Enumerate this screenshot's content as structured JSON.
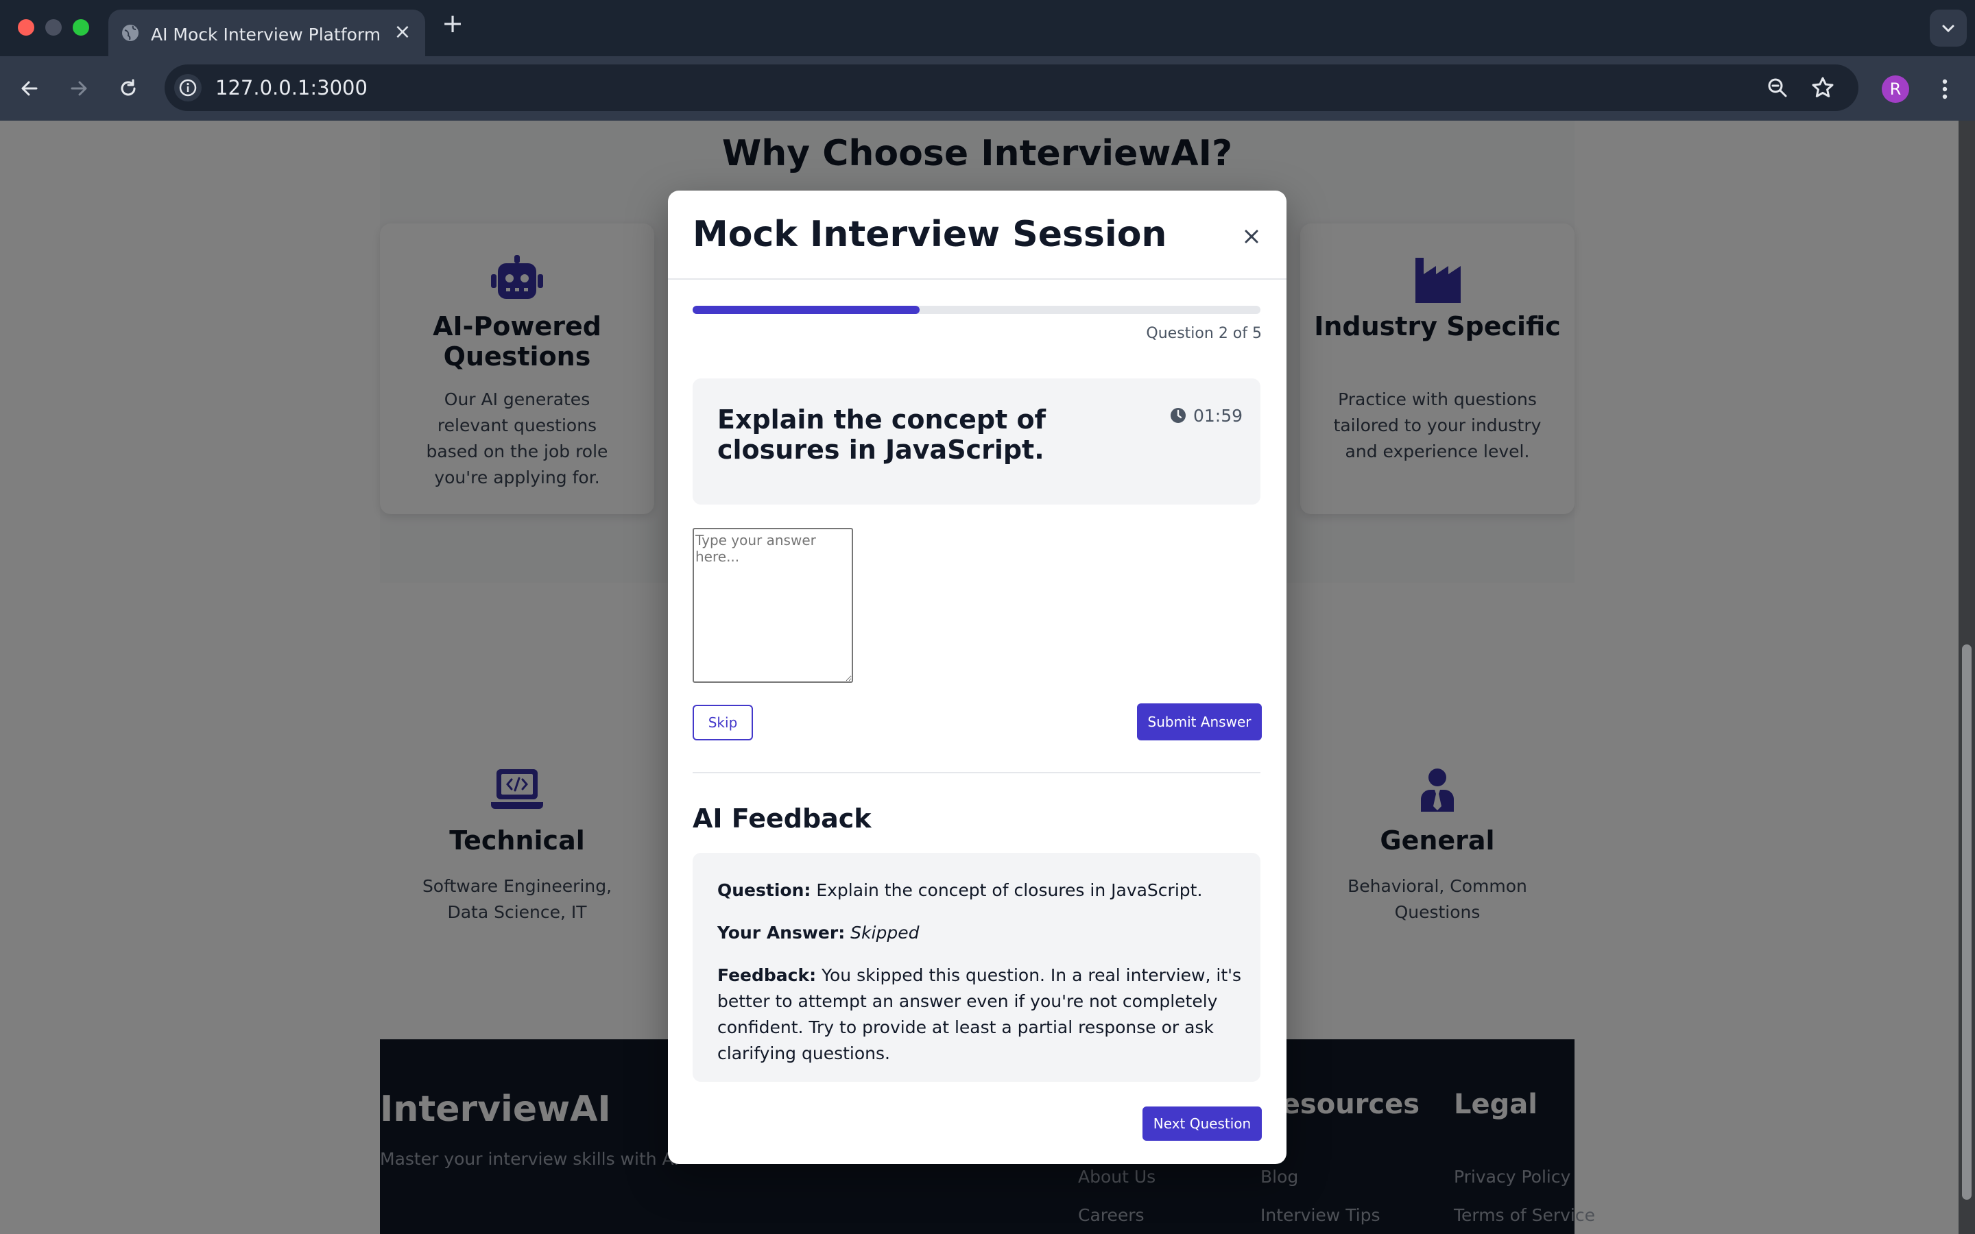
{
  "browser": {
    "tab_title": "AI Mock Interview Platform",
    "url": "127.0.0.1:3000",
    "profile_initial": "R"
  },
  "page": {
    "why_title": "Why Choose InterviewAI?",
    "features": [
      {
        "title": "AI-Powered Questions",
        "description": "Our AI generates relevant questions based on the job role you're applying for.",
        "icon": "robot-icon"
      },
      {
        "title": "Industry Specific",
        "description": "Practice with questions tailored to your industry and experience level.",
        "icon": "industry-icon"
      }
    ],
    "categories": [
      {
        "title": "Technical",
        "description": "Software Engineering, Data Science, IT",
        "icon": "laptop-code-icon"
      },
      {
        "title": "General",
        "description": "Behavioral, Common Questions",
        "icon": "user-tie-icon"
      }
    ],
    "footer": {
      "brand": "InterviewAI",
      "tagline": "Master your interview skills with AI",
      "columns": [
        {
          "heading": "",
          "links": [
            "About Us",
            "Careers"
          ]
        },
        {
          "heading": "Resources",
          "links": [
            "Blog",
            "Interview Tips"
          ]
        },
        {
          "heading": "Legal",
          "links": [
            "Privacy Policy",
            "Terms of Service"
          ]
        }
      ]
    }
  },
  "modal": {
    "title": "Mock Interview Session",
    "progress_fraction": 0.4,
    "progress_label": "Question 2 of 5",
    "question": "Explain the concept of closures in JavaScript.",
    "timer": "01:59",
    "answer_placeholder": "Type your answer here...",
    "answer_value": "",
    "skip_label": "Skip",
    "submit_label": "Submit Answer",
    "feedback_title": "AI Feedback",
    "feedback": {
      "question_label": "Question:",
      "question_text": "Explain the concept of closures in JavaScript.",
      "answer_label": "Your Answer:",
      "answer_text": "Skipped",
      "feedback_label": "Feedback:",
      "feedback_text": "You skipped this question. In a real interview, it's better to attempt an answer even if you're not completely confident. Try to provide at least a partial response or ask clarifying questions."
    },
    "next_label": "Next Question"
  },
  "colors": {
    "accent": "#4338ca",
    "text_dark": "#111827",
    "footer_bg": "#111827"
  }
}
